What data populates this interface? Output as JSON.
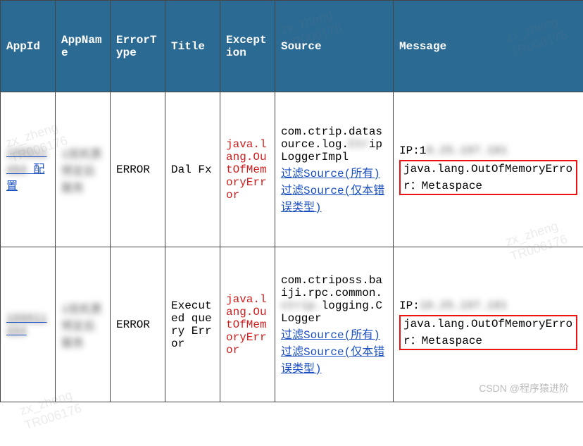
{
  "headers": {
    "appId": "AppId",
    "appName": "AppName",
    "errorType": "ErrorType",
    "title": "Title",
    "exception": "Exception",
    "source": "Source",
    "message": "Message"
  },
  "rows": [
    {
      "appId_prefix": "100011",
      "appId_mid": "494",
      "appId_suffix": " 配置",
      "appName": "1班机票预定后服务",
      "errorType": "ERROR",
      "title": "Dal Fx",
      "exception": "java.lang.OutOfMemoryError",
      "source_text": "com.ctrip.datasource.log.",
      "source_text2": "ipLoggerImpl",
      "source_blur": "Ctr",
      "source_filter1": "过滤Source(所有)",
      "source_filter2": "过滤Source(仅本错误类型)",
      "msg_ip_label": "IP:1",
      "msg_ip_blur": "0.25.197.181",
      "msg_error": "java.lang.OutOfMemoryError：Metaspace"
    },
    {
      "appId_prefix": "100011",
      "appId_mid": "494",
      "appId_suffix": "",
      "appName": "1班机票预定后服务",
      "errorType": "ERROR",
      "title": "Executed query Error",
      "exception": "java.lang.OutOfMemoryError",
      "source_text": "com.ctriposs.baiji.rpc.common.",
      "source_text2": "logging.CLogger",
      "source_blur": "ctrip.",
      "source_filter1": "过滤Source(所有)",
      "source_filter2": "过滤Source(仅本错误类型)",
      "msg_ip_label": "IP:",
      "msg_ip_blur": "10.25.197.181",
      "msg_error": "java.lang.OutOfMemoryError：Metaspace"
    }
  ],
  "watermark": "zx_zheng\nTR006176",
  "credit": "CSDN @程序猿进阶"
}
